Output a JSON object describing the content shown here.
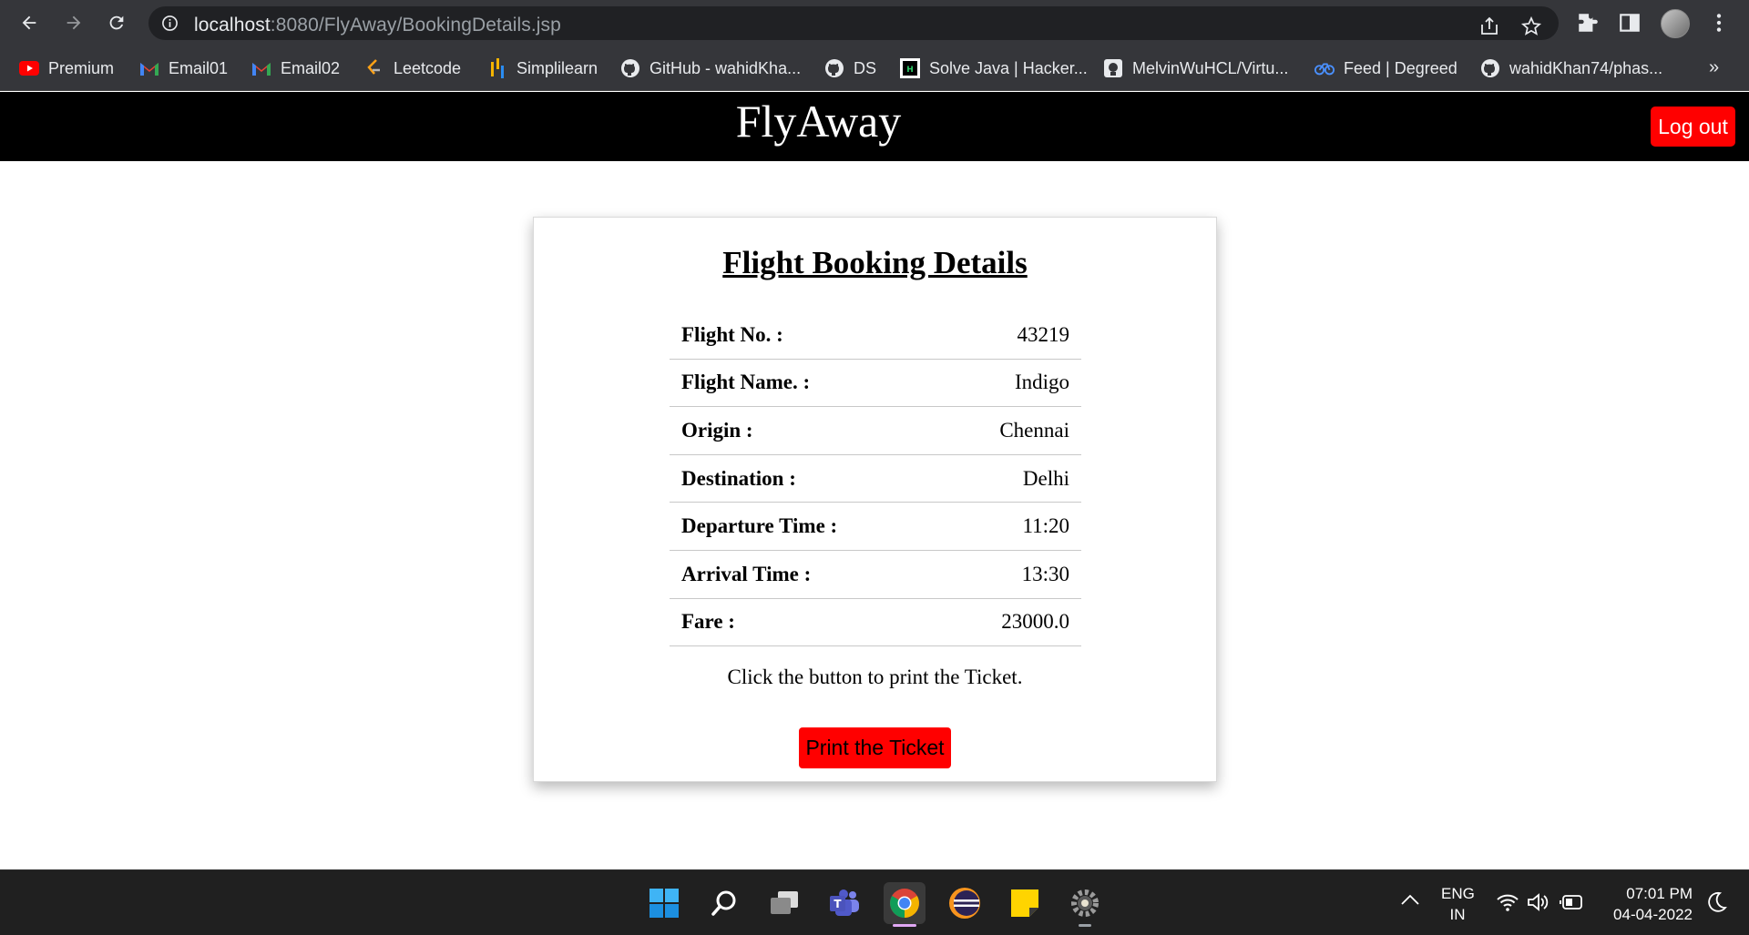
{
  "browser": {
    "url_host": "localhost",
    "url_rest": ":8080/FlyAway/BookingDetails.jsp",
    "bookmarks": [
      {
        "label": "Premium",
        "icon": "youtube-icon"
      },
      {
        "label": "Email01",
        "icon": "gmail-icon"
      },
      {
        "label": "Email02",
        "icon": "gmail-icon"
      },
      {
        "label": "Leetcode",
        "icon": "leetcode-icon"
      },
      {
        "label": "Simplilearn",
        "icon": "simplilearn-icon"
      },
      {
        "label": "GitHub - wahidKha...",
        "icon": "github-icon"
      },
      {
        "label": "DS",
        "icon": "github-icon"
      },
      {
        "label": "Solve Java | Hacker...",
        "icon": "hackerrank-icon"
      },
      {
        "label": "MelvinWuHCL/Virtu...",
        "icon": "repo-icon"
      },
      {
        "label": "Feed | Degreed",
        "icon": "degreed-icon"
      },
      {
        "label": "wahidKhan74/phas...",
        "icon": "github-icon"
      }
    ],
    "more_label": "»"
  },
  "site": {
    "title": "FlyAway",
    "logout_label": "Log out"
  },
  "booking": {
    "heading": "Flight Booking Details",
    "rows": [
      {
        "label": "Flight No. :",
        "value": "43219"
      },
      {
        "label": "Flight Name. :",
        "value": "Indigo"
      },
      {
        "label": "Origin :",
        "value": "Chennai"
      },
      {
        "label": "Destination :",
        "value": "Delhi"
      },
      {
        "label": "Departure Time :",
        "value": "11:20"
      },
      {
        "label": "Arrival Time :",
        "value": "13:30"
      },
      {
        "label": "Fare :",
        "value": "23000.0"
      }
    ],
    "note": "Click the button to print the Ticket.",
    "print_label": "Print the Ticket"
  },
  "taskbar": {
    "apps": [
      "windows-start-icon",
      "search-icon",
      "task-view-icon",
      "teams-icon",
      "chrome-icon",
      "eclipse-icon",
      "sticky-notes-icon",
      "settings-icon"
    ],
    "lang_line1": "ENG",
    "lang_line2": "IN",
    "time": "07:01 PM",
    "date": "04-04-2022"
  },
  "colors": {
    "accent_red": "#ff0000",
    "header_black": "#000000",
    "chrome_dark": "#35363a"
  }
}
